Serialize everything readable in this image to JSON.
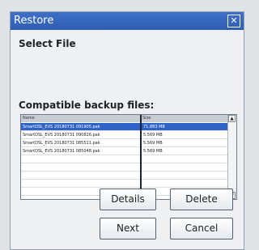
{
  "window": {
    "title": "Restore"
  },
  "heading": "Select File",
  "files_label": "Compatible backup files:",
  "table": {
    "columns": [
      "Name",
      "Size"
    ],
    "rows": [
      {
        "name": "SmartDSL_EVS 20180731 091905.pak",
        "size": "71.883 MB",
        "selected": true
      },
      {
        "name": "SmartDSL_EVS 20180731 090826.pak",
        "size": "5.569 MB",
        "selected": false
      },
      {
        "name": "SmartDSL_EVS 20180731 085511.pak",
        "size": "5.569 MB",
        "selected": false
      },
      {
        "name": "SmartDSL_EVS 20180731 085048.pak",
        "size": "5.569 MB",
        "selected": false
      }
    ]
  },
  "buttons": {
    "details": "Details",
    "delete": "Delete",
    "next": "Next",
    "cancel": "Cancel"
  }
}
